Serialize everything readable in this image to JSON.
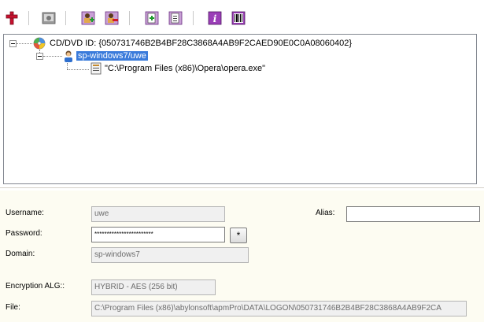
{
  "toolbar": {
    "buttons": [
      {
        "icon": "red-cross-icon"
      },
      {
        "icon": "disk-image-icon"
      },
      {
        "icon": "add-user-icon"
      },
      {
        "icon": "remove-user-icon"
      },
      {
        "icon": "add-document-icon"
      },
      {
        "icon": "remove-document-icon"
      },
      {
        "icon": "info-icon"
      },
      {
        "icon": "barcode-icon"
      }
    ]
  },
  "tree": {
    "root_label": "CD/DVD ID: {050731746B2B4BF28C3868A4AB9F2CAED90E0C0A08060402}",
    "user_label": "sp-windows7/uwe",
    "file_label": "\"C:\\Program Files (x86)\\Opera\\opera.exe\""
  },
  "form": {
    "username_label": "Username:",
    "username_value": "uwe",
    "alias_label": "Alias:",
    "alias_value": "",
    "password_label": "Password:",
    "password_value": "************************",
    "password_button": "*",
    "domain_label": "Domain:",
    "domain_value": "sp-windows7",
    "encryption_label": "Encryption ALG::",
    "encryption_value": "HYBRID - AES (256 bit)",
    "file_label": "File:",
    "file_value": "C:\\Program Files (x86)\\abylonsoft\\apmPro\\DATA\\LOGON\\050731746B2B4BF28C3868A4AB9F2CA"
  },
  "colors": {
    "selection": "#3a7bdb",
    "panel_background": "#fdfcf2"
  }
}
